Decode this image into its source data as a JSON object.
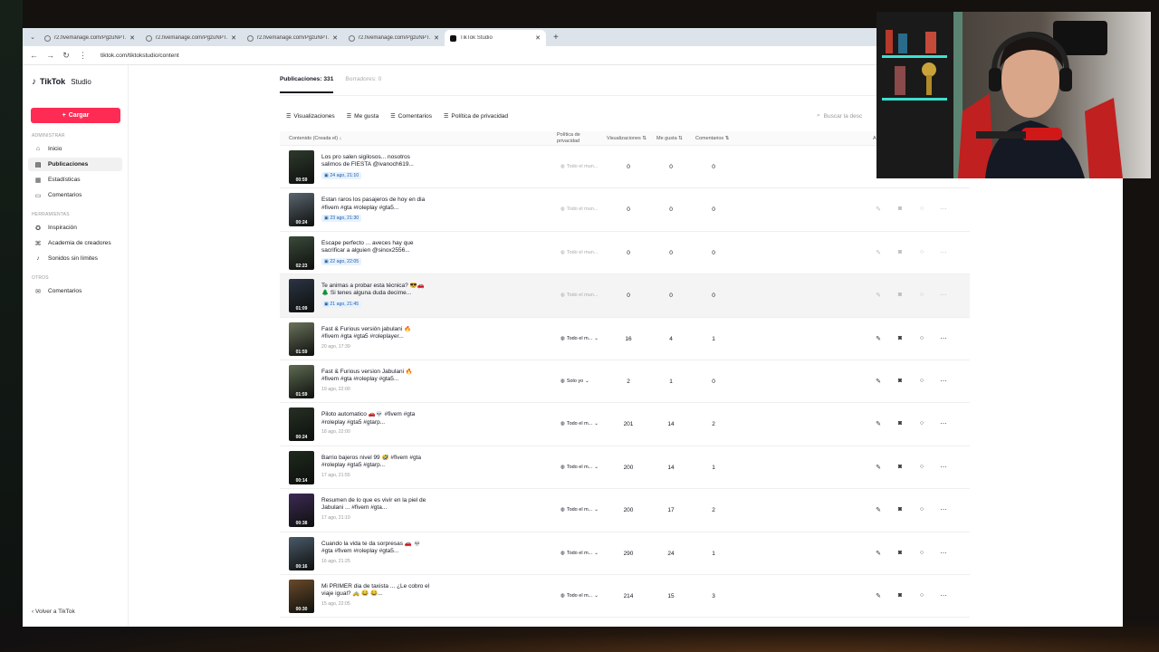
{
  "browser": {
    "tabs": [
      {
        "label": "r2.fivemanage.com/PgzuNPTZ...",
        "icon": "globe-icon"
      },
      {
        "label": "r2.fivemanage.com/PgzuNPTZ...",
        "icon": "globe-icon"
      },
      {
        "label": "r2.fivemanage.com/PgzuNPTZ...",
        "icon": "globe-icon"
      },
      {
        "label": "r2.fivemanage.com/PgzuNPTZ...",
        "icon": "globe-icon"
      },
      {
        "label": "TikTok Studio",
        "icon": "tiktok-icon"
      }
    ],
    "url": "tiktok.com/tiktokstudio/content"
  },
  "sidebar": {
    "logo": "TikTok",
    "logo_suffix": "Studio",
    "upload_label": "Cargar",
    "sections": [
      {
        "title": "ADMINISTRAR",
        "items": [
          {
            "label": "Inicio",
            "icon": "home-icon"
          },
          {
            "label": "Publicaciones",
            "icon": "posts-icon",
            "active": true
          },
          {
            "label": "Estadísticas",
            "icon": "stats-icon"
          },
          {
            "label": "Comentarios",
            "icon": "comments-icon"
          }
        ]
      },
      {
        "title": "HERRAMIENTAS",
        "items": [
          {
            "label": "Inspiración",
            "icon": "bulb-icon"
          },
          {
            "label": "Academia de creadores",
            "icon": "academy-icon"
          },
          {
            "label": "Sonidos sin límites",
            "icon": "music-icon"
          }
        ]
      },
      {
        "title": "OTROS",
        "items": [
          {
            "label": "Comentarios",
            "icon": "feedback-icon"
          }
        ]
      }
    ],
    "back_label": "Volver a TikTok"
  },
  "main": {
    "tab_posts": "Publicaciones: 331",
    "tab_drafts": "Borradores: 0",
    "filters": [
      "Visualizaciones",
      "Me gusta",
      "Comentarios",
      "Política de privacidad"
    ],
    "search_placeholder": "Buscar la desc",
    "columns": {
      "content": "Contenido (Creada el)",
      "privacy": "Política de privacidad",
      "views": "Visualizaciones",
      "likes": "Me gusta",
      "comments": "Comentarios",
      "actions": "A"
    },
    "rows": [
      {
        "duration": "00:59",
        "caption": "Los pro salen sigilosos... nosotros salimos de FIESTA @ivanoch619...",
        "date": "24 ago, 21:10",
        "scheduled": true,
        "privacy": "Todo el mun...",
        "views": "0",
        "likes": "0",
        "comments": "0",
        "thumb_color": "#2e3a2c"
      },
      {
        "duration": "00:24",
        "caption": "Estan raros los pasajeros de hoy en dia #fivem #gta #roleplay #gta5...",
        "date": "23 ago, 21:30",
        "scheduled": true,
        "privacy": "Todo el mun...",
        "views": "0",
        "likes": "0",
        "comments": "0",
        "thumb_color": "#5b6670"
      },
      {
        "duration": "02:23",
        "caption": "Escape perfecto ... aveces hay que sacrificar a alguien @sinox2556...",
        "date": "22 ago, 22:05",
        "scheduled": true,
        "privacy": "Todo el mun...",
        "views": "0",
        "likes": "0",
        "comments": "0",
        "thumb_color": "#3b4a3a"
      },
      {
        "duration": "01:09",
        "caption": "Te animas a probar esta técnica? 😎🚗🌲 Si tenes alguna duda decime...",
        "date": "21 ago, 21:45",
        "scheduled": true,
        "privacy": "Todo el mun...",
        "views": "0",
        "likes": "0",
        "comments": "0",
        "thumb_color": "#2c3443",
        "hover": true
      },
      {
        "duration": "01:59",
        "caption": "Fast & Furious versión jabulani 🔥 #fivem #gta #gta5 #roleplayer...",
        "date": "20 ago, 17:39",
        "scheduled": false,
        "privacy": "Todo el m...",
        "views": "16",
        "likes": "4",
        "comments": "1",
        "thumb_color": "#6b735c"
      },
      {
        "duration": "01:59",
        "caption": "Fast & Furious version Jabulani 🔥 #fivem #gta #roleplay #gta5...",
        "date": "19 ago, 22:00",
        "scheduled": false,
        "privacy": "Solo yo",
        "views": "2",
        "likes": "1",
        "comments": "0",
        "thumb_color": "#5e6b52"
      },
      {
        "duration": "00:24",
        "caption": "Piloto automatico 🚗💀 #fivem #gta #roleplay #gta5 #gtarp...",
        "date": "18 ago, 22:00",
        "scheduled": false,
        "privacy": "Todo el m...",
        "views": "201",
        "likes": "14",
        "comments": "2",
        "thumb_color": "#263024"
      },
      {
        "duration": "00:14",
        "caption": "Barrio bajeros nivel 99 🤣 #fivem #gta #roleplay #gta5 #gtarp...",
        "date": "17 ago, 21:55",
        "scheduled": false,
        "privacy": "Todo el m...",
        "views": "200",
        "likes": "14",
        "comments": "1",
        "thumb_color": "#1f2a1d"
      },
      {
        "duration": "00:38",
        "caption": "Resumen de lo que es vivir en la piel de Jabulani ... #fivem #gta...",
        "date": "17 ago, 21:10",
        "scheduled": false,
        "privacy": "Todo el m...",
        "views": "200",
        "likes": "17",
        "comments": "2",
        "thumb_color": "#3d2a55"
      },
      {
        "duration": "00:16",
        "caption": "Cuando la vida te da sorpresas 🚗 💀 #gta #fivem #roleplay #gta5...",
        "date": "16 ago, 21:25",
        "scheduled": false,
        "privacy": "Todo el m...",
        "views": "290",
        "likes": "24",
        "comments": "1",
        "thumb_color": "#4a5a6a"
      },
      {
        "duration": "00:30",
        "caption": "Mi PRIMER dia de taxista ... ¿Le cobro el viaje igual? 🚕 😂 😂...",
        "date": "15 ago, 22:05",
        "scheduled": false,
        "privacy": "Todo el m...",
        "views": "214",
        "likes": "15",
        "comments": "3",
        "thumb_color": "#6a4a2a"
      }
    ],
    "action_icons": [
      "edit-icon",
      "stats-icon",
      "comment-icon",
      "more-icon"
    ]
  },
  "colors": {
    "accent": "#fe2c55",
    "scheduled_pill_bg": "#e8f2fd",
    "scheduled_pill_text": "#1b5ea8"
  }
}
